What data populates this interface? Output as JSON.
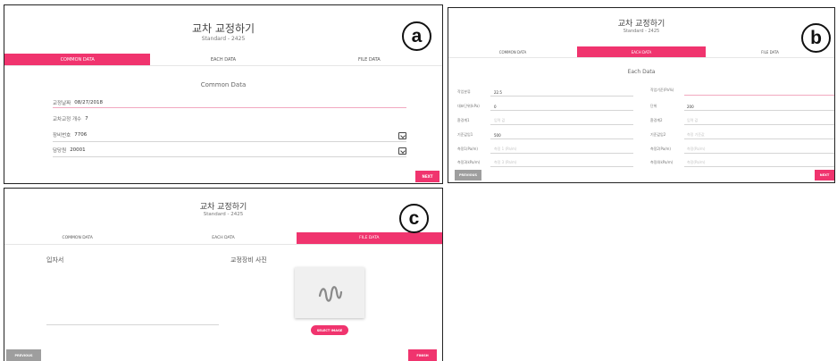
{
  "header": {
    "title": "교차 교정하기",
    "subtitle": "Standard - 2425"
  },
  "tabs": {
    "common": "COMMON DATA",
    "each": "EACH DATA",
    "file": "FILE DATA"
  },
  "badges": {
    "a": "a",
    "b": "b",
    "c": "c"
  },
  "panel_a": {
    "section_title": "Common Data",
    "fields": [
      {
        "label": "교정날짜",
        "value": "08/27/2018"
      },
      {
        "label": "교차교정 개수",
        "value": "7"
      },
      {
        "label": "장비번호",
        "value": "7706"
      },
      {
        "label": "담당원",
        "value": "20001"
      }
    ],
    "next": "NEXT"
  },
  "panel_b": {
    "section_title": "Each Data",
    "rows": [
      {
        "left_label": "작업분류",
        "left_value": "22.5",
        "right_label": "작업기준(Pa%)",
        "right_value": ""
      },
      {
        "left_label": "대표단위(kPa)",
        "left_value": "0",
        "right_label": "단위",
        "right_value": "200"
      },
      {
        "left_label": "환경계1",
        "left_value": "입력 값",
        "right_label": "환경계2",
        "right_value": "입력 값"
      },
      {
        "left_label": "기준값입1",
        "left_value": "500",
        "right_label": "기준값입2",
        "right_value": "측정 기준값"
      },
      {
        "left_label": "측정1(Pa/m)",
        "left_value": "측정 1 (Pa/m)",
        "right_label": "측정2(Pa/m)",
        "right_value": "측정(Pa/m)"
      },
      {
        "left_label": "측정3(kPa/m)",
        "left_value": "측정 3 (Pa/m)",
        "right_label": "측정4(kPa/m)",
        "right_value": "측정(Pa/m)"
      }
    ],
    "previous": "PREVIOUS",
    "next": "NEXT"
  },
  "panel_c": {
    "signature_label": "입자서",
    "photo_label": "교정장비 사진",
    "photo_placeholder_icon": "squiggle-photo-placeholder",
    "select_button": "SELECT IMAGE",
    "previous": "PREVIOUS",
    "finish": "FINISH"
  },
  "colors": {
    "accent": "#f0346e",
    "grey_button": "#9e9e9e"
  }
}
